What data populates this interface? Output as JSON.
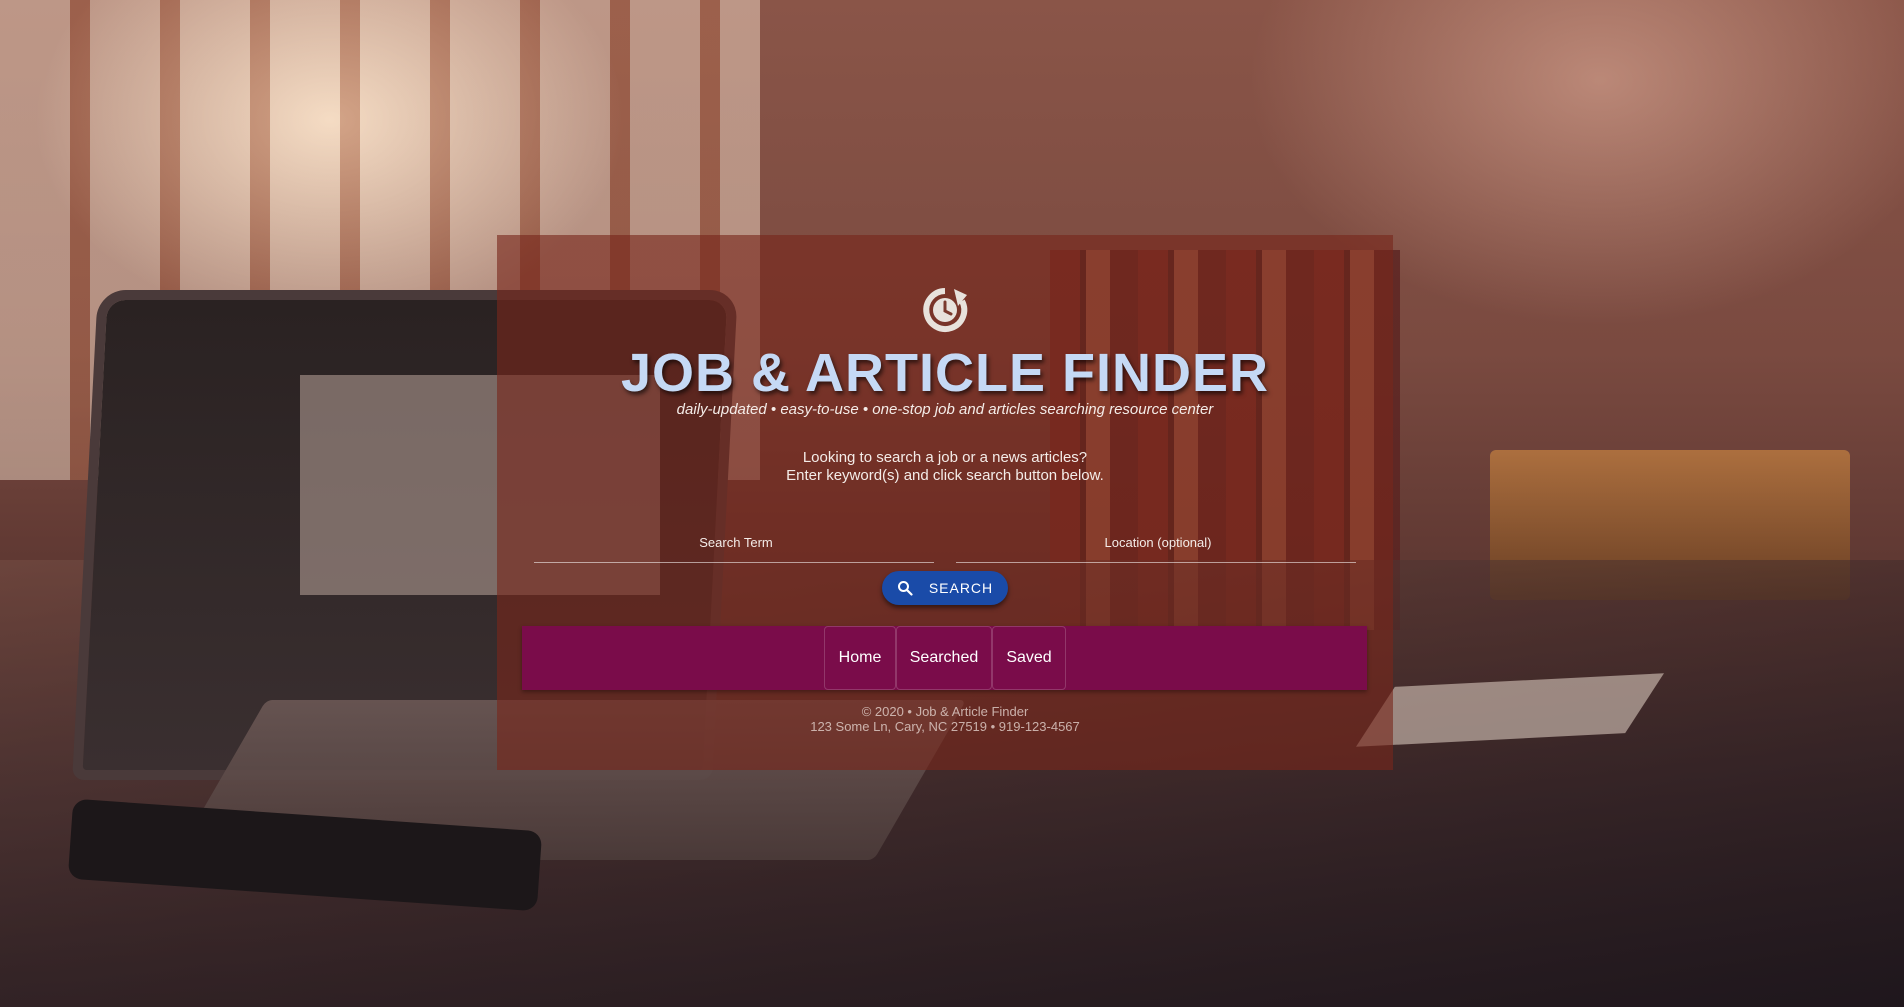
{
  "header": {
    "title": "JOB & ARTICLE FINDER",
    "tagline": "daily-updated • easy-to-use • one-stop job and articles searching resource center",
    "logo_icon": "clock-refresh-icon"
  },
  "intro": {
    "line1": "Looking to search a job or a news articles?",
    "line2": "Enter keyword(s) and click search button below."
  },
  "search": {
    "term_placeholder": "Search Term",
    "term_value": "",
    "location_placeholder": "Location (optional)",
    "location_value": "",
    "button_label": "SEARCH",
    "button_icon": "search-icon",
    "button_color": "#1a4ba8"
  },
  "nav": {
    "background_color": "#7a0c4a",
    "items": [
      {
        "label": "Home"
      },
      {
        "label": "Searched"
      },
      {
        "label": "Saved"
      }
    ]
  },
  "footer": {
    "line1": "© 2020 • Job & Article Finder",
    "line2": "123 Some Ln, Cary, NC 27519 • 919-123-4567"
  }
}
